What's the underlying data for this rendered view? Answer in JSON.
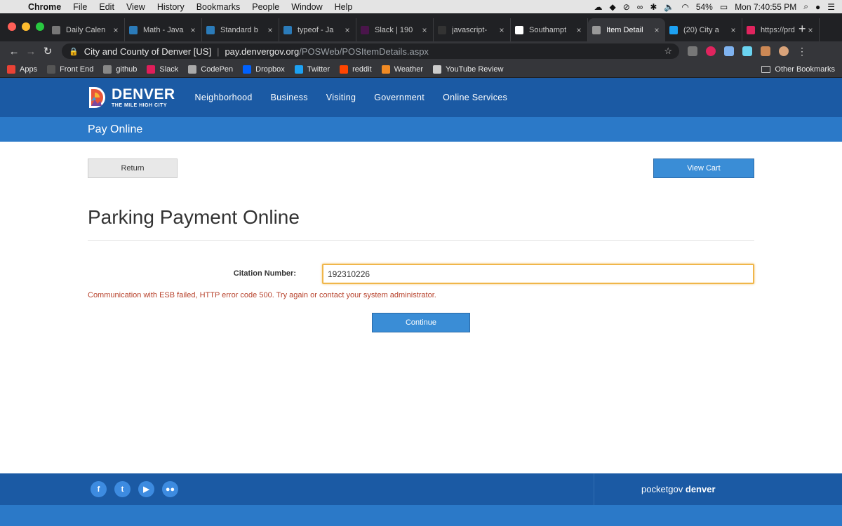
{
  "mac_menu": {
    "app": "Chrome",
    "items": [
      "File",
      "Edit",
      "View",
      "History",
      "Bookmarks",
      "People",
      "Window",
      "Help"
    ],
    "battery": "54%",
    "clock": "Mon 7:40:55 PM"
  },
  "tabs": [
    {
      "title": "Daily Calen",
      "color": "#777"
    },
    {
      "title": "Math - Java",
      "color": "#2b7bb9"
    },
    {
      "title": "Standard b",
      "color": "#2b7bb9"
    },
    {
      "title": "typeof - Ja",
      "color": "#2b7bb9"
    },
    {
      "title": "Slack | 190",
      "color": "#4a154b"
    },
    {
      "title": "javascript-",
      "color": "#333"
    },
    {
      "title": "Southampt",
      "color": "#fff"
    },
    {
      "title": "Item Detail",
      "color": "#999"
    },
    {
      "title": "(20) City a",
      "color": "#1da1f2"
    },
    {
      "title": "https://prd",
      "color": "#e0245e"
    }
  ],
  "address": {
    "site": "City and County of Denver [US]",
    "host": "pay.denvergov.org",
    "path": "/POSWeb/POSItemDetails.aspx"
  },
  "bookmarks": {
    "items": [
      {
        "label": "Apps",
        "color": "#e94235"
      },
      {
        "label": "Front End",
        "color": "#555"
      },
      {
        "label": "github",
        "color": "#888"
      },
      {
        "label": "Slack",
        "color": "#e01e5a"
      },
      {
        "label": "CodePen",
        "color": "#aaa"
      },
      {
        "label": "Dropbox",
        "color": "#0061fe"
      },
      {
        "label": "Twitter",
        "color": "#1da1f2"
      },
      {
        "label": "reddit",
        "color": "#ff4500"
      },
      {
        "label": "Weather",
        "color": "#f08a24"
      },
      {
        "label": "YouTube Review",
        "color": "#ccc"
      }
    ],
    "other": "Other Bookmarks"
  },
  "header": {
    "logo_main": "DENVER",
    "logo_sub": "THE MILE HIGH CITY",
    "nav": [
      "Neighborhood",
      "Business",
      "Visiting",
      "Government",
      "Online Services"
    ]
  },
  "subbar": {
    "title": "Pay Online"
  },
  "page": {
    "return_label": "Return",
    "cart_label": "View Cart",
    "heading": "Parking Payment Online",
    "citation_label": "Citation Number:",
    "citation_value": "192310226",
    "error": "Communication with ESB failed, HTTP error code 500. Try again or contact your system administrator.",
    "continue_label": "Continue"
  },
  "footer": {
    "social": [
      "f",
      "t",
      "▶",
      "●●"
    ],
    "brand_prefix": "pocketgov",
    "brand_bold": "denver"
  },
  "colors": {
    "header_blue": "#1b5aa4",
    "subbar_blue": "#2b79c8",
    "button_blue": "#3a8dd6",
    "error_red": "#b8442e"
  }
}
